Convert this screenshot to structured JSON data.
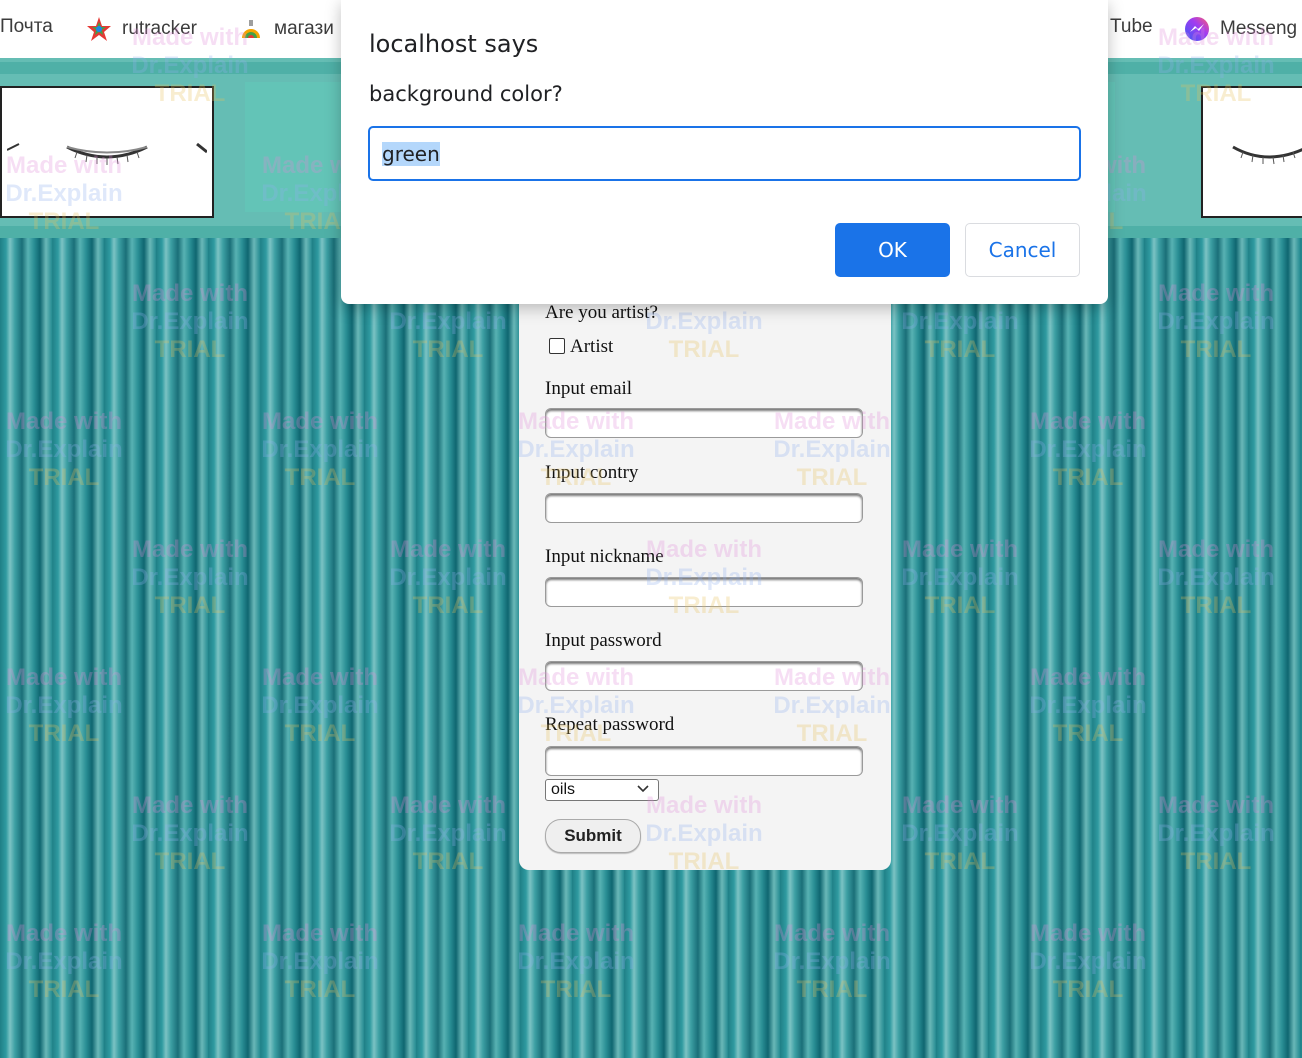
{
  "bookmarks": [
    {
      "label": "Почта",
      "icon": "mail-icon"
    },
    {
      "label": "rutracker",
      "icon": "rutracker-icon"
    },
    {
      "label": "магази",
      "icon": "shop-icon"
    },
    {
      "label": "Tube",
      "icon": "youtube-icon"
    },
    {
      "label": "Messeng",
      "icon": "messenger-icon"
    }
  ],
  "dialog": {
    "title": "localhost says",
    "message": "background color?",
    "input_value": "green",
    "ok_label": "OK",
    "cancel_label": "Cancel"
  },
  "form": {
    "artist_question": "Are you artist?",
    "artist_checkbox_label": "Artist",
    "artist_checked": false,
    "email_label": "Input email",
    "country_label": "Input contry",
    "nickname_label": "Input nickname",
    "password_label": "Input password",
    "repeat_password_label": "Repeat password",
    "medium_selected": "oils",
    "submit_label": "Submit"
  },
  "watermark": {
    "line1": "Made with",
    "line2": "Dr.Explain",
    "line3": "TRIAL"
  },
  "colors": {
    "dialog_accent": "#1a73e8",
    "teal_background": "#2f9aa0",
    "header_band": "#65bdb4"
  }
}
